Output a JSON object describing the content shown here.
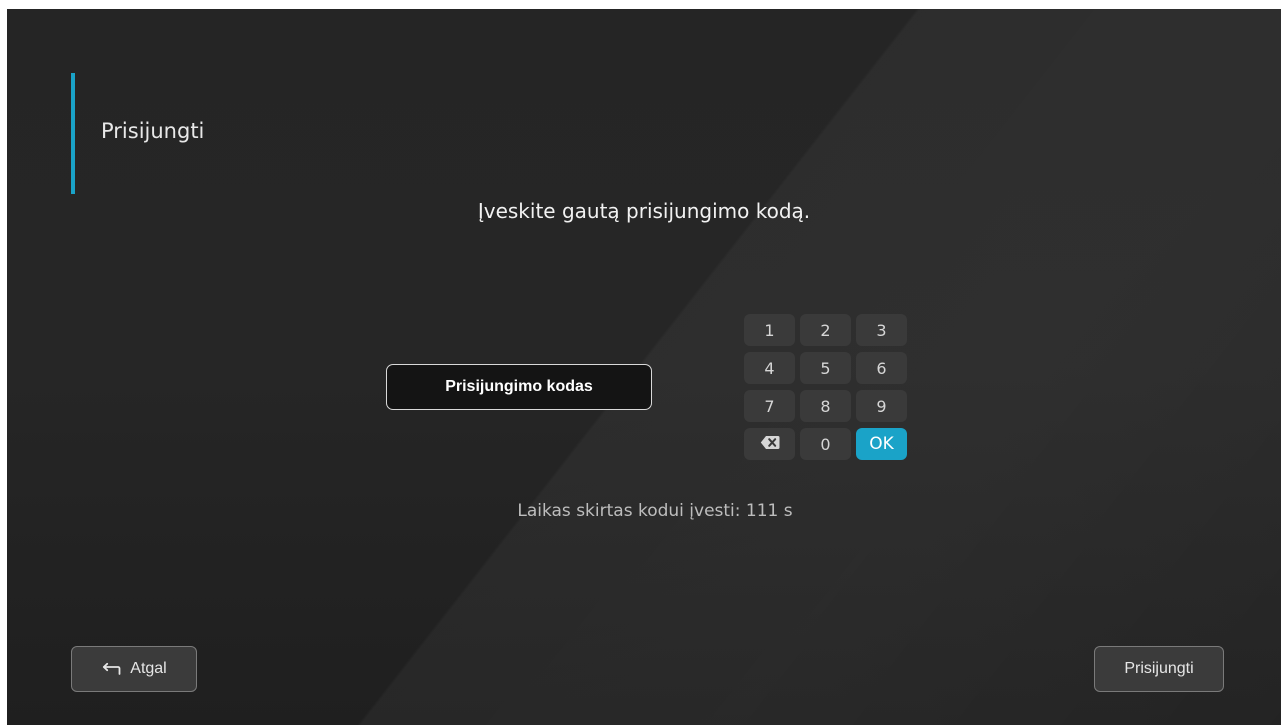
{
  "page": {
    "title": "Prisijungti",
    "instruction": "Įveskite gautą prisijungimo kodą."
  },
  "code_input": {
    "placeholder": "Prisijungimo kodas",
    "value": ""
  },
  "keypad": {
    "keys": [
      "1",
      "2",
      "3",
      "4",
      "5",
      "6",
      "7",
      "8",
      "9"
    ],
    "backspace_icon": "backspace-icon",
    "zero": "0",
    "ok": "OK"
  },
  "timer": {
    "text": "Laikas skirtas kodui įvesti: 111 s"
  },
  "footer": {
    "back_label": "Atgal",
    "back_icon": "return-arrow-icon",
    "login_label": "Prisijungti"
  },
  "colors": {
    "accent": "#1aa3c8",
    "background": "#252525",
    "key_background": "#3a3a3a"
  }
}
